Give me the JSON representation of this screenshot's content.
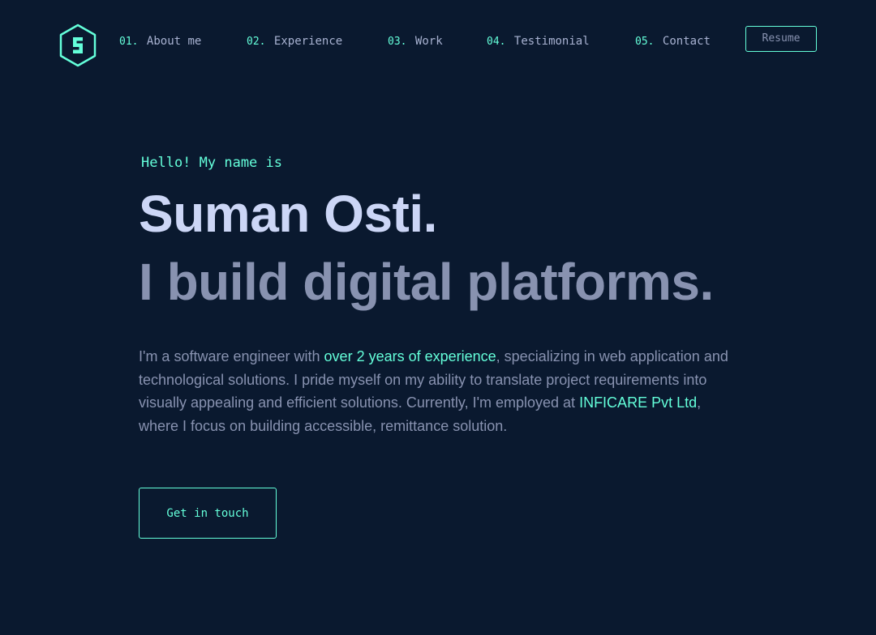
{
  "colors": {
    "background": "#0a192f",
    "accent": "#64ffda",
    "heading": "#ccd6f6",
    "text": "#8892b0",
    "nav_text": "#a8b2d1"
  },
  "logo": {
    "letter": "S",
    "icon": "hexagon-logo-icon"
  },
  "nav": {
    "items": [
      {
        "num": "01.",
        "label": "About me"
      },
      {
        "num": "02.",
        "label": "Experience"
      },
      {
        "num": "03.",
        "label": "Work"
      },
      {
        "num": "04.",
        "label": "Testimonial"
      },
      {
        "num": "05.",
        "label": "Contact"
      }
    ],
    "resume_label": "Resume"
  },
  "hero": {
    "greeting": "Hello! My name is",
    "name": "Suman Osti.",
    "tagline": "I build digital platforms.",
    "bio": {
      "part1": "I'm a software engineer with ",
      "highlight1": "over 2 years of experience",
      "part2": ", specializing in web application and technological solutions. I pride myself on my ability to translate project requirements into visually appealing and efficient solutions. Currently, I'm employed at ",
      "highlight2": "INFICARE Pvt Ltd",
      "part3": ", where I focus on building accessible, remittance solution."
    },
    "cta_label": "Get in touch"
  }
}
